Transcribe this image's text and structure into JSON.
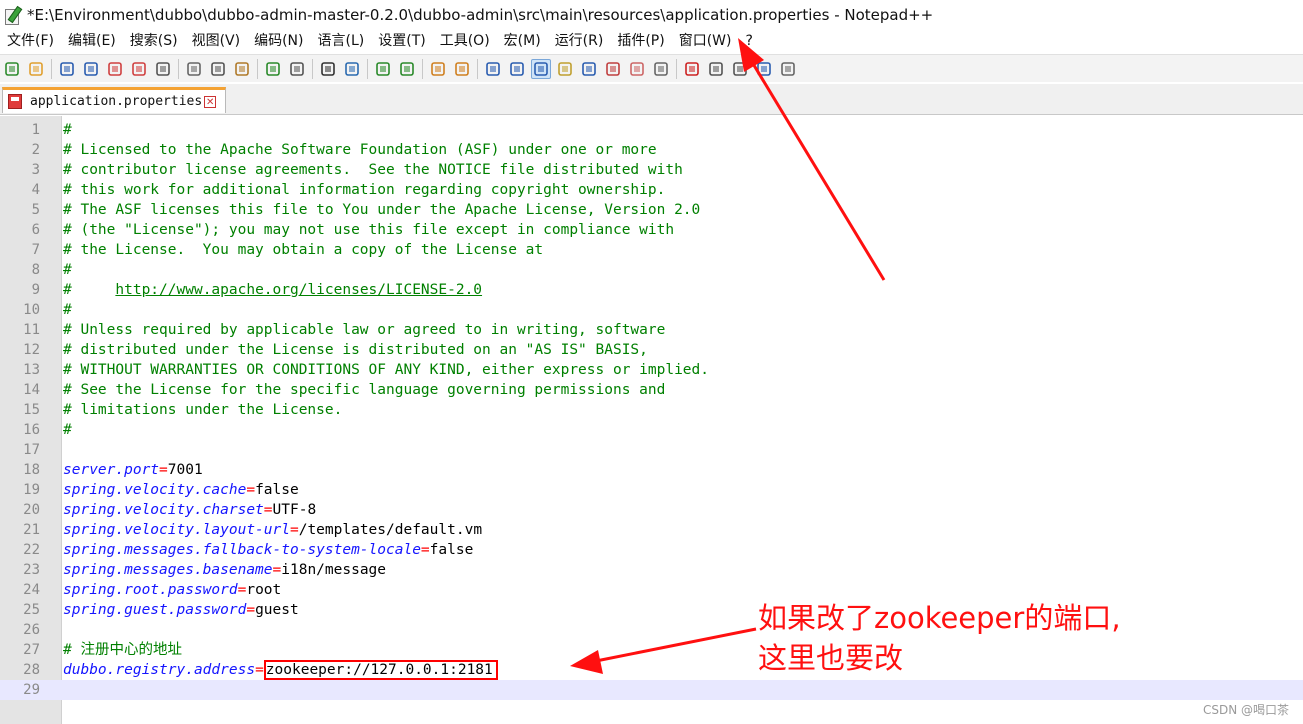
{
  "window": {
    "title": "*E:\\Environment\\dubbo\\dubbo-admin-master-0.2.0\\dubbo-admin\\src\\main\\resources\\application.properties - Notepad++"
  },
  "menu": [
    "文件(F)",
    "编辑(E)",
    "搜索(S)",
    "视图(V)",
    "编码(N)",
    "语言(L)",
    "设置(T)",
    "工具(O)",
    "宏(M)",
    "运行(R)",
    "插件(P)",
    "窗口(W)",
    "?"
  ],
  "toolbar": {
    "icons": [
      "new-file-icon",
      "open-file-icon",
      "save-icon",
      "save-all-icon",
      "close-icon",
      "close-all-icon",
      "print-icon",
      "cut-icon",
      "copy-icon",
      "paste-icon",
      "undo-icon",
      "redo-icon",
      "find-icon",
      "replace-icon",
      "zoom-in-icon",
      "zoom-out-icon",
      "sync-vertical-icon",
      "sync-horizontal-icon",
      "word-wrap-icon",
      "show-all-chars-icon",
      "indent-guide-icon",
      "document-map-icon",
      "function-list-icon",
      "folder-workspace-icon",
      "udl-icon",
      "monitor-icon",
      "record-macro-icon",
      "stop-record-icon",
      "play-macro-icon",
      "run-macro-multiple-icon",
      "save-macro-icon"
    ]
  },
  "tab": {
    "label": "application.properties",
    "close": "✕"
  },
  "editor": {
    "lines": [
      {
        "n": "1",
        "type": "comment",
        "text": "#"
      },
      {
        "n": "2",
        "type": "comment",
        "text": "# Licensed to the Apache Software Foundation (ASF) under one or more"
      },
      {
        "n": "3",
        "type": "comment",
        "text": "# contributor license agreements.  See the NOTICE file distributed with"
      },
      {
        "n": "4",
        "type": "comment",
        "text": "# this work for additional information regarding copyright ownership."
      },
      {
        "n": "5",
        "type": "comment",
        "text": "# The ASF licenses this file to You under the Apache License, Version 2.0"
      },
      {
        "n": "6",
        "type": "comment",
        "text": "# (the \"License\"); you may not use this file except in compliance with"
      },
      {
        "n": "7",
        "type": "comment",
        "text": "# the License.  You may obtain a copy of the License at"
      },
      {
        "n": "8",
        "type": "comment",
        "text": "#"
      },
      {
        "n": "9",
        "type": "url",
        "prefix": "#     ",
        "text": "http://www.apache.org/licenses/LICENSE-2.0"
      },
      {
        "n": "10",
        "type": "comment",
        "text": "#"
      },
      {
        "n": "11",
        "type": "comment",
        "text": "# Unless required by applicable law or agreed to in writing, software"
      },
      {
        "n": "12",
        "type": "comment",
        "text": "# distributed under the License is distributed on an \"AS IS\" BASIS,"
      },
      {
        "n": "13",
        "type": "comment",
        "text": "# WITHOUT WARRANTIES OR CONDITIONS OF ANY KIND, either express or implied."
      },
      {
        "n": "14",
        "type": "comment",
        "text": "# See the License for the specific language governing permissions and"
      },
      {
        "n": "15",
        "type": "comment",
        "text": "# limitations under the License."
      },
      {
        "n": "16",
        "type": "comment",
        "text": "#"
      },
      {
        "n": "17",
        "type": "blank",
        "text": ""
      },
      {
        "n": "18",
        "type": "prop",
        "key": "server.port",
        "value": "7001"
      },
      {
        "n": "19",
        "type": "prop",
        "key": "spring.velocity.cache",
        "value": "false"
      },
      {
        "n": "20",
        "type": "prop",
        "key": "spring.velocity.charset",
        "value": "UTF-8"
      },
      {
        "n": "21",
        "type": "prop",
        "key": "spring.velocity.layout-url",
        "value": "/templates/default.vm"
      },
      {
        "n": "22",
        "type": "prop",
        "key": "spring.messages.fallback-to-system-locale",
        "value": "false"
      },
      {
        "n": "23",
        "type": "prop",
        "key": "spring.messages.basename",
        "value": "i18n/message"
      },
      {
        "n": "24",
        "type": "prop",
        "key": "spring.root.password",
        "value": "root"
      },
      {
        "n": "25",
        "type": "prop",
        "key": "spring.guest.password",
        "value": "guest"
      },
      {
        "n": "26",
        "type": "blank",
        "text": ""
      },
      {
        "n": "27",
        "type": "comment",
        "text": "# 注册中心的地址"
      },
      {
        "n": "28",
        "type": "prop",
        "key": "dubbo.registry.address",
        "value": "zookeeper://127.0.0.1:2181",
        "highlight": true
      },
      {
        "n": "29",
        "type": "blank",
        "text": "",
        "current": true
      }
    ]
  },
  "annotation": {
    "text": "如果改了zookeeper的端口,\n这里也要改"
  },
  "watermark": "CSDN @喝口茶"
}
